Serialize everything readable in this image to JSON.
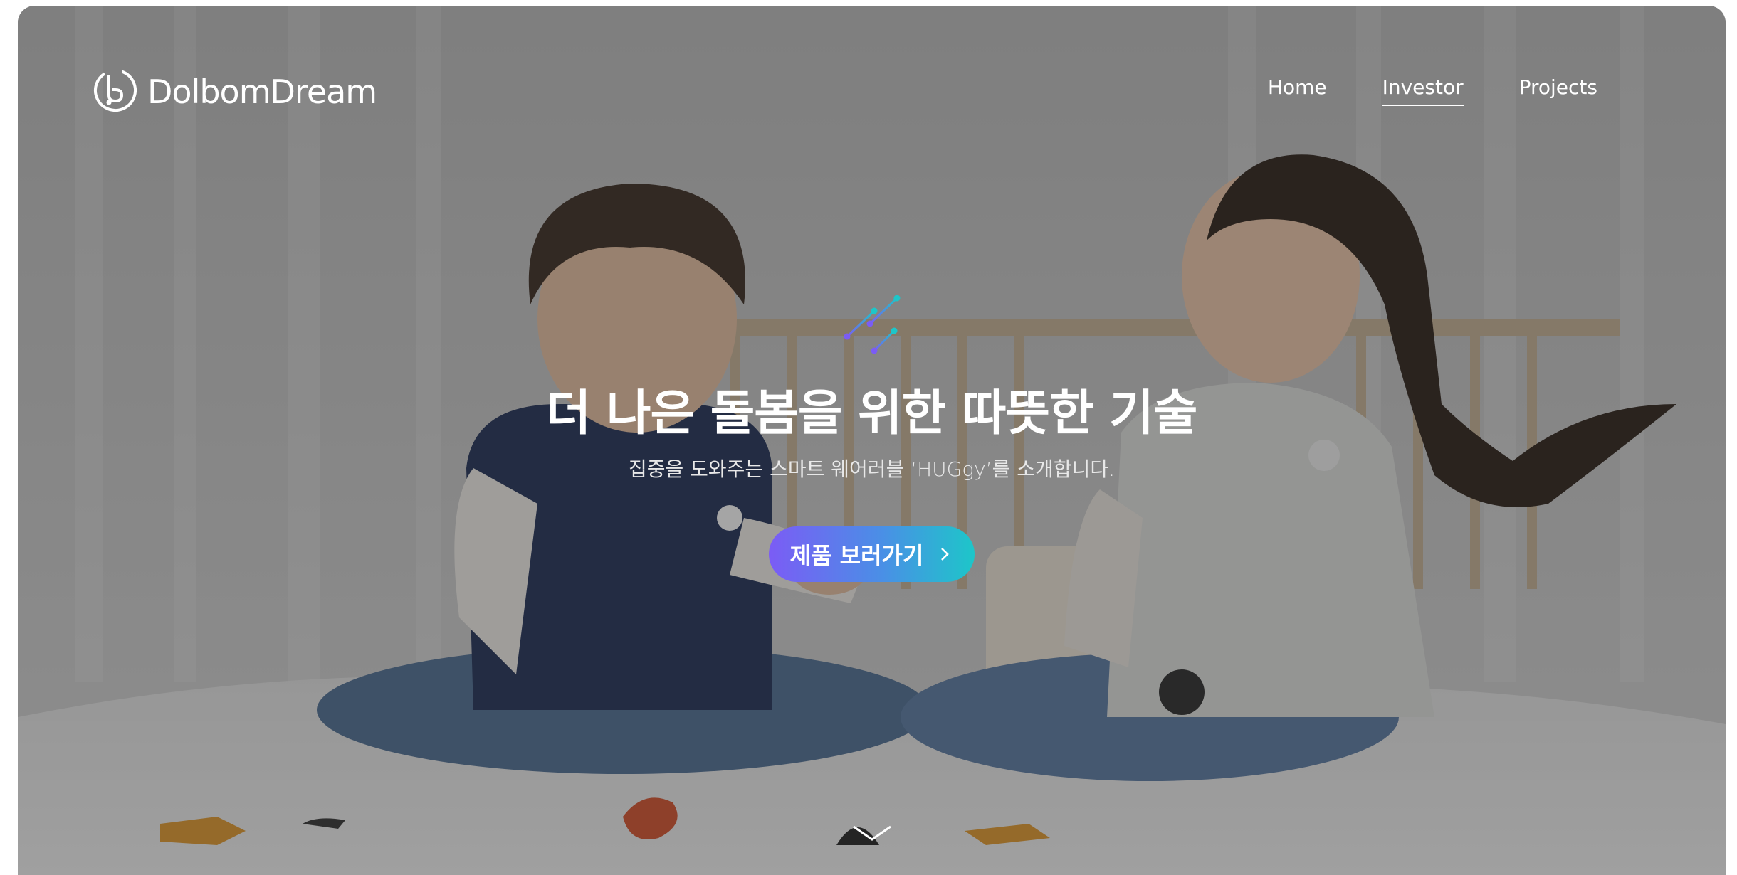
{
  "brand": {
    "name": "DolbomDream",
    "logo_icon": "dolbom-logo-icon"
  },
  "nav": {
    "items": [
      {
        "label": "Home",
        "active": false
      },
      {
        "label": "Investor",
        "active": true
      },
      {
        "label": "Projects",
        "active": false
      }
    ]
  },
  "hero": {
    "headline": "더 나은 돌봄을 위한 따뜻한 기술",
    "subline": "집중을 도와주는 스마트 웨어러블 ‘HUGgy’를 소개합니다.",
    "cta_label": "제품 보러가기",
    "cta_icon": "chevron-right-icon",
    "scroll_icon": "chevron-down-icon",
    "decoration_icon": "sparkle-lines-icon"
  },
  "colors": {
    "cta_gradient_start": "#7b5cf5",
    "cta_gradient_end": "#1dc6c9",
    "overlay": "#282828",
    "text": "#ffffff"
  }
}
